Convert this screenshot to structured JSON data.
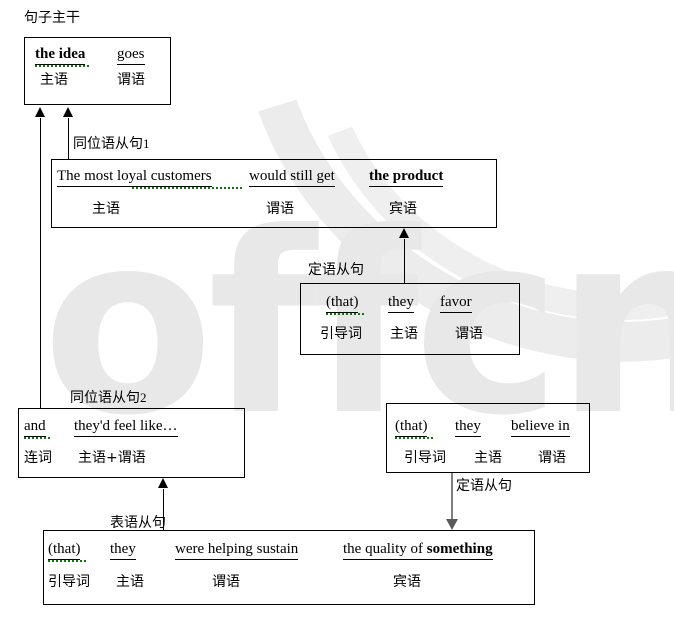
{
  "diagram": {
    "title_label": "句子主干",
    "watermark": "offcn",
    "boxes": {
      "main_clause": {
        "name": "句子主干",
        "english": [
          "the idea",
          "goes"
        ],
        "roles": [
          "主语",
          "谓语"
        ]
      },
      "appositive_1": {
        "name": "同位语从句",
        "number": "1",
        "english": [
          "The most loyal customers",
          "would still get",
          "the product"
        ],
        "roles": [
          "主语",
          "谓语",
          "宾语"
        ]
      },
      "attributive_1": {
        "name": "定语从句",
        "english": [
          "(that)",
          "they",
          "favor"
        ],
        "roles": [
          "引导词",
          "主语",
          "谓语"
        ]
      },
      "appositive_2": {
        "name": "同位语从句",
        "number": "2",
        "english": [
          "and",
          "they'd feel like…"
        ],
        "roles": [
          "连词",
          "主语+谓语"
        ]
      },
      "attributive_2": {
        "name": "定语从句",
        "english": [
          "(that)",
          "they",
          "believe in"
        ],
        "roles": [
          "引导词",
          "主语",
          "谓语"
        ]
      },
      "predicative": {
        "name": "表语从句",
        "english": [
          "(that)",
          "they",
          "were helping sustain",
          "the quality of ",
          "something"
        ],
        "roles": [
          "引导词",
          "主语",
          "谓语",
          "宾语"
        ]
      }
    },
    "connector_labels": {
      "appositive_1": "同位语从句",
      "appositive_1_num": "1",
      "attributive_1": "定语从句",
      "appositive_2": "同位语从句",
      "appositive_2_num": "2",
      "attributive_2": "定语从句",
      "predicative": "表语从句"
    },
    "colors": {
      "grammar_underline": "#008000",
      "box_border": "#000000",
      "arrow_black": "#000000",
      "arrow_gray": "#5a5a5a",
      "watermark": "#e8e8e8"
    }
  }
}
